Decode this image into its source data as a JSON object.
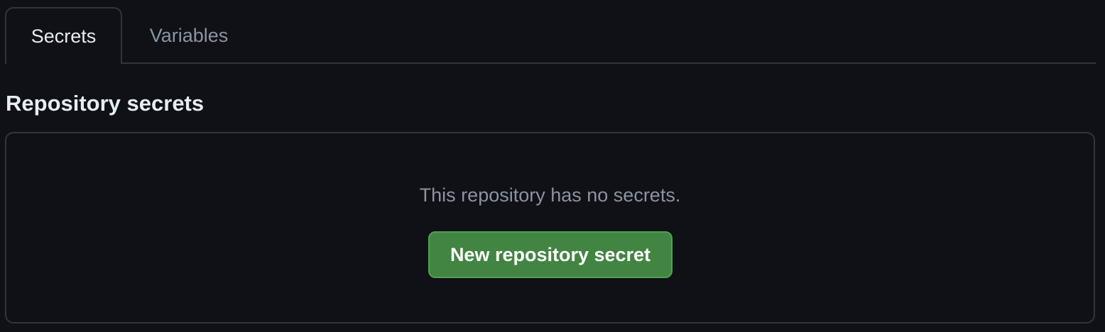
{
  "tabs": [
    {
      "label": "Secrets",
      "active": true
    },
    {
      "label": "Variables",
      "active": false
    }
  ],
  "section": {
    "title": "Repository secrets",
    "empty_message": "This repository has no secrets.",
    "new_button_label": "New repository secret"
  },
  "colors": {
    "background": "#0f1116",
    "border": "#30363d",
    "text_primary": "#e6edf3",
    "text_muted": "#8b949e",
    "button_green": "#428442"
  }
}
